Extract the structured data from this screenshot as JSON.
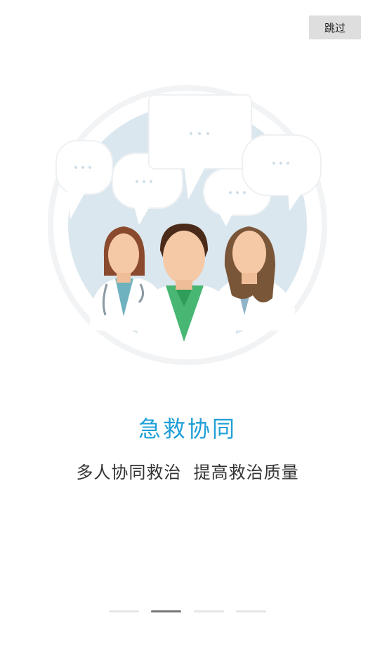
{
  "skip": {
    "label": "跳过"
  },
  "slide": {
    "title": "急救协同",
    "subtitle": "多人协同救治  提高救治质量"
  },
  "pager": {
    "count": 4,
    "active_index": 1
  },
  "colors": {
    "accent": "#1f9fd6",
    "circle": "#dbe7ee",
    "scrub_green": "#47b773",
    "active_indicator": "#777777"
  }
}
